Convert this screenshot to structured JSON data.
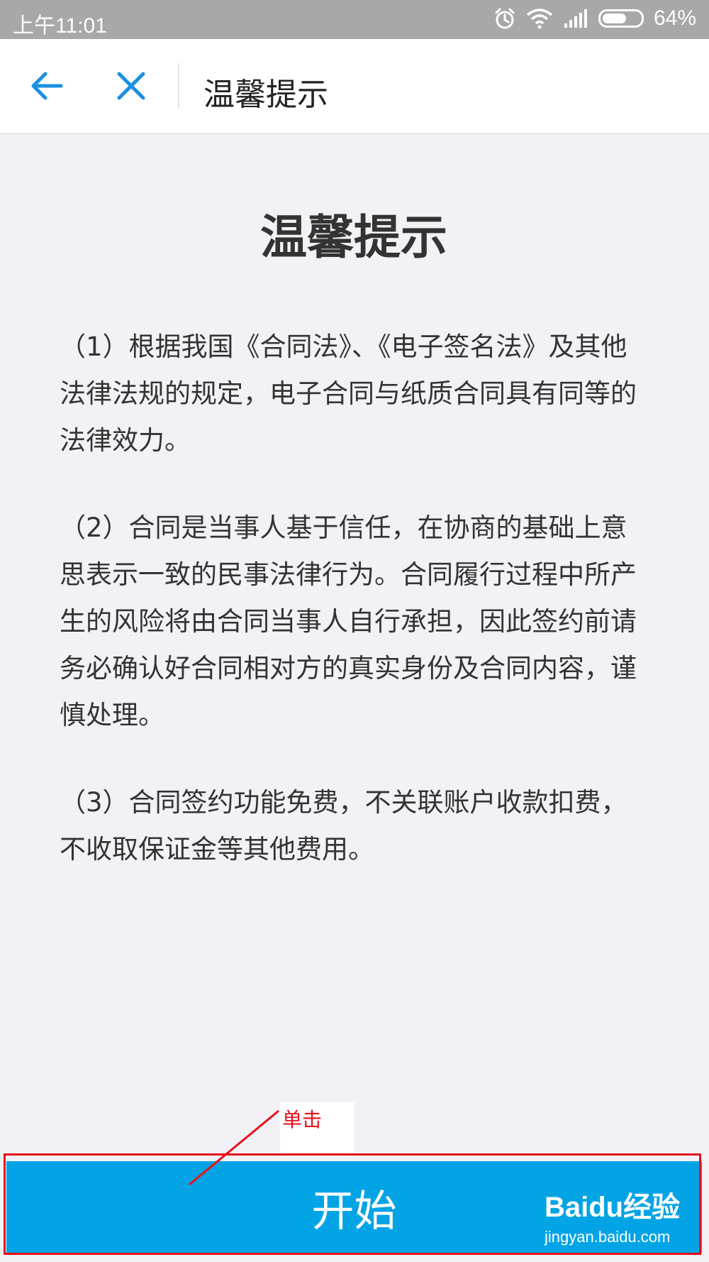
{
  "status_bar": {
    "time": "上午11:01",
    "battery": "64%",
    "battery_level": 0.64
  },
  "header": {
    "title": "温馨提示",
    "back_icon": "arrow-left-icon",
    "close_icon": "close-icon"
  },
  "content": {
    "title": "温馨提示",
    "paragraphs": [
      "（1）根据我国《合同法》、《电子签名法》及其他法律法规的规定，电子合同与纸质合同具有同等的法律效力。",
      "（2）合同是当事人基于信任，在协商的基础上意思表示一致的民事法律行为。合同履行过程中所产生的风险将由合同当事人自行承担，因此签约前请务必确认好合同相对方的真实身份及合同内容，谨慎处理。",
      "（3）合同签约功能免费，不关联账户收款扣费，不收取保证金等其他费用。"
    ]
  },
  "start_button": {
    "label": "开始"
  },
  "annotation": {
    "text": "单击"
  },
  "watermark": {
    "logo": "Baidu经验",
    "url": "jingyan.baidu.com"
  },
  "colors": {
    "accent": "#1a8fe3",
    "button": "#03a4e5",
    "annotation": "#e8101a"
  }
}
